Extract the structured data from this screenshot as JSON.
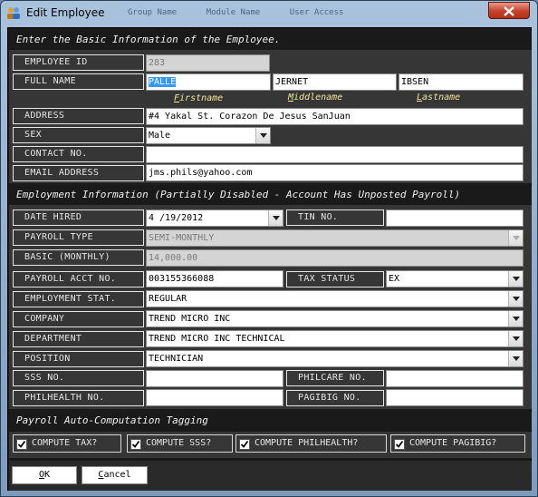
{
  "window": {
    "title": "Edit Employee",
    "ghost_tabs": "Group Name      Module Name      User Access"
  },
  "sections": {
    "basic": "Enter the Basic Information of the Employee.",
    "employment": "Employment Information (Partially Disabled - Account Has Unposted Payroll)",
    "payroll_tagging": "Payroll Auto-Computation Tagging"
  },
  "basic": {
    "employee_id": {
      "label": "EMPLOYEE ID",
      "value": "283"
    },
    "full_name": {
      "label": "FULL NAME",
      "first": "PALLE",
      "middle": "JERNET",
      "last": "IBSEN"
    },
    "name_captions": {
      "first_u": "F",
      "first_rest": "irstname",
      "middle_u": "M",
      "middle_rest": "iddlename",
      "last_u": "L",
      "last_rest": "astname"
    },
    "address": {
      "label": "ADDRESS",
      "value": "#4 Yakal St. Corazon De Jesus SanJuan"
    },
    "sex": {
      "label": "SEX",
      "value": "Male"
    },
    "contact": {
      "label": "CONTACT NO.",
      "value": ""
    },
    "email": {
      "label": "EMAIL ADDRESS",
      "value": "jms.phils@yahoo.com"
    }
  },
  "employment": {
    "date_hired": {
      "label": "DATE HIRED",
      "value": "4 /19/2012"
    },
    "tin": {
      "label": "TIN NO.",
      "value": ""
    },
    "payroll_type": {
      "label": "PAYROLL TYPE",
      "value": "SEMI-MONTHLY"
    },
    "basic_monthly": {
      "label": "BASIC (MONTHLY)",
      "value": "14,000.00"
    },
    "payroll_acct": {
      "label": "PAYROLL ACCT NO.",
      "value": "003155366088"
    },
    "tax_status": {
      "label": "TAX STATUS",
      "value": "EX"
    },
    "employment_stat": {
      "label": "EMPLOYMENT STAT.",
      "value": "REGULAR"
    },
    "company": {
      "label": "COMPANY",
      "value": "TREND MICRO INC"
    },
    "department": {
      "label": "DEPARTMENT",
      "value": "TREND MICRO INC TECHNICAL"
    },
    "position": {
      "label": "POSITION",
      "value": "TECHNICIAN"
    },
    "sss": {
      "label": "SSS NO.",
      "value": ""
    },
    "philcare": {
      "label": "PHILCARE NO.",
      "value": ""
    },
    "philhealth": {
      "label": "PHILHEALTH NO.",
      "value": ""
    },
    "pagibig": {
      "label": "PAGIBIG NO.",
      "value": ""
    }
  },
  "tagging": {
    "tax": {
      "label": "COMPUTE TAX?",
      "checked": true
    },
    "sss": {
      "label": "COMPUTE SSS?",
      "checked": true
    },
    "philhealth": {
      "label": "COMPUTE PHILHEALTH?",
      "checked": true
    },
    "pagibig": {
      "label": "COMPUTE PAGIBIG?",
      "checked": true
    }
  },
  "buttons": {
    "ok_u": "O",
    "ok_rest": "K",
    "cancel_u": "C",
    "cancel_rest": "ancel"
  },
  "colors": {
    "panel": "#363636",
    "background": "#1a1a1a",
    "caption": "#f2e79a",
    "selection": "#3399ff",
    "close": "#c6412a"
  },
  "icons": {
    "app": "people-icon",
    "close": "close-icon",
    "dropdown": "chevron-down-icon",
    "check": "check-icon"
  }
}
